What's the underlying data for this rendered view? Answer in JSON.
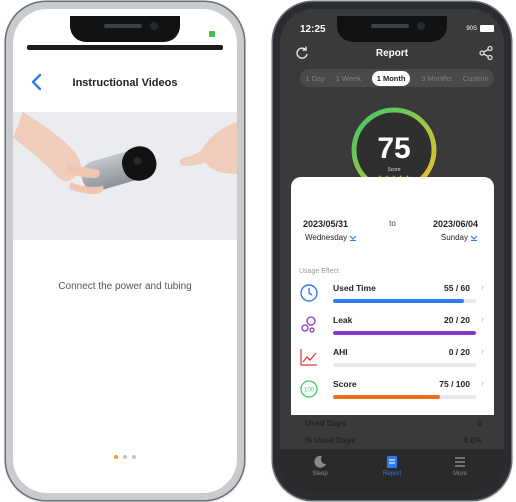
{
  "left_phone": {
    "nav": {
      "title": "Instructional Videos"
    },
    "caption": "Connect the power and tubing",
    "page_indicator": {
      "total": 3,
      "active_index": 0
    }
  },
  "right_phone": {
    "status": {
      "time": "12:25",
      "network": "90S"
    },
    "header": {
      "title": "Report"
    },
    "range_tabs": [
      "1 Day",
      "1 Week",
      "1 Month",
      "3 Months",
      "Custom"
    ],
    "active_range": "1 Month",
    "score": {
      "value": "75",
      "label": "Score",
      "stars": "★★★★★"
    },
    "date_range": {
      "start_date": "2023/05/31",
      "start_day": "Wednesday",
      "to": "to",
      "end_date": "2023/06/04",
      "end_day": "Sunday"
    },
    "usage_effect": {
      "header": "Usage Effect",
      "metrics": [
        {
          "name": "Used Time",
          "value": "55 / 60",
          "fraction": 0.917,
          "color": "#2f7bf5",
          "icon": "clock-icon"
        },
        {
          "name": "Leak",
          "value": "20 / 20",
          "fraction": 1.0,
          "color": "#8a36c8",
          "icon": "bubbles-icon"
        },
        {
          "name": "AHI",
          "value": "0 / 20",
          "fraction": 0.0,
          "color": "#e23b3b",
          "icon": "trend-icon"
        },
        {
          "name": "Score",
          "value": "75 / 100",
          "fraction": 0.75,
          "color": "#f26a1b",
          "icon": "score-100-icon"
        }
      ]
    },
    "summary": [
      {
        "label": "Used Days",
        "value": "0"
      },
      {
        "label": "% Used Days",
        "value": "0.0%"
      }
    ],
    "tabbar": [
      {
        "label": "Sleep",
        "icon": "moon-icon",
        "active": false
      },
      {
        "label": "Report",
        "icon": "report-icon",
        "active": true
      },
      {
        "label": "More",
        "icon": "menu-icon",
        "active": false
      }
    ],
    "colors": {
      "accent": "#2f7bf5",
      "ring_start": "#39c86a",
      "ring_end": "#f2c12e"
    }
  }
}
